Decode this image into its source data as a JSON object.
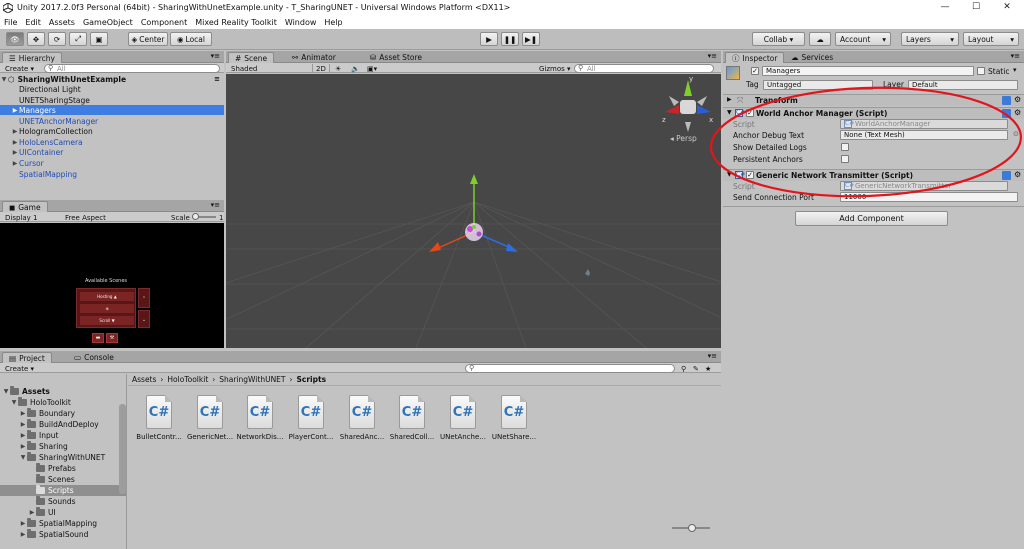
{
  "window": {
    "title": "Unity 2017.2.0f3 Personal (64bit) - SharingWithUnetExample.unity - T_SharingUNET - Universal Windows Platform <DX11>",
    "minimize": "—",
    "maximize": "☐",
    "close": "✕"
  },
  "menu": [
    "File",
    "Edit",
    "Assets",
    "GameObject",
    "Component",
    "Mixed Reality Toolkit",
    "Window",
    "Help"
  ],
  "toolbar": {
    "center": "Center",
    "local": "Local",
    "collab": "Collab ▾",
    "account": "Account",
    "layers": "Layers",
    "layout": "Layout"
  },
  "hierarchy": {
    "tab": "Hierarchy",
    "create": "Create ▾",
    "search_placeholder": "All",
    "scene_name": "SharingWithUnetExample",
    "items": [
      {
        "label": "Directional Light"
      },
      {
        "label": "UNETSharingStage"
      },
      {
        "label": "Managers"
      },
      {
        "label": "UNETAnchorManager"
      },
      {
        "label": "HologramCollection"
      },
      {
        "label": "HoloLensCamera"
      },
      {
        "label": "UIContainer"
      },
      {
        "label": "Cursor"
      },
      {
        "label": "SpatialMapping"
      }
    ]
  },
  "scene": {
    "tab": "Scene",
    "tab_animator": "Animator",
    "tab_asset_store": "Asset Store",
    "shading": "Shaded",
    "mode_2d": "2D",
    "gizmos": "Gizmos ▾",
    "search_placeholder": "All",
    "persp_label": "Persp",
    "gizmo_x": "x",
    "gizmo_y": "y",
    "gizmo_z": "z"
  },
  "game": {
    "tab": "Game",
    "display": "Display 1",
    "aspect": "Free Aspect",
    "scale_label": "Scale",
    "scale_value": "1",
    "menu_title": "Available Scenes",
    "menu_items": [
      "Hosting ▲",
      "⊕",
      "Scroll ▼"
    ]
  },
  "project": {
    "tab": "Project",
    "tab_console": "Console",
    "create": "Create ▾",
    "breadcrumb": [
      "Assets",
      "HoloToolkit",
      "SharingWithUNET",
      "Scripts"
    ],
    "tree": [
      {
        "label": "Assets"
      },
      {
        "label": "HoloToolkit"
      },
      {
        "label": "Boundary"
      },
      {
        "label": "BuildAndDeploy"
      },
      {
        "label": "Input"
      },
      {
        "label": "Sharing"
      },
      {
        "label": "SharingWithUNET"
      },
      {
        "label": "Prefabs"
      },
      {
        "label": "Scenes"
      },
      {
        "label": "Scripts"
      },
      {
        "label": "Sounds"
      },
      {
        "label": "UI"
      },
      {
        "label": "SpatialMapping"
      },
      {
        "label": "SpatialSound"
      }
    ],
    "files": [
      {
        "name": "BulletContr..."
      },
      {
        "name": "GenericNet..."
      },
      {
        "name": "NetworkDis..."
      },
      {
        "name": "PlayerCont..."
      },
      {
        "name": "SharedAnc..."
      },
      {
        "name": "SharedColl..."
      },
      {
        "name": "UNetAnche..."
      },
      {
        "name": "UNetShare..."
      }
    ]
  },
  "inspector": {
    "tab": "Inspector",
    "tab_services": "Services",
    "object_name": "Managers",
    "static_label": "Static",
    "tag_label": "Tag",
    "tag_value": "Untagged",
    "layer_label": "Layer",
    "layer_value": "Default",
    "components": {
      "transform": {
        "title": "Transform"
      },
      "world_anchor": {
        "title": "World Anchor Manager (Script)",
        "script_label": "Script",
        "script_value": "WorldAnchorManager",
        "debug_label": "Anchor Debug Text",
        "debug_value": "None (Text Mesh)",
        "detailed_logs_label": "Show Detailed Logs",
        "persistent_label": "Persistent Anchors"
      },
      "network_transmitter": {
        "title": "Generic Network Transmitter (Script)",
        "script_label": "Script",
        "script_value": "GenericNetworkTransmitter",
        "port_label": "Send Connection Port",
        "port_value": "11000"
      }
    },
    "add_component": "Add Component"
  },
  "colors": {
    "selection": "#3e7de1",
    "prefab_text": "#1f4bb8",
    "annotation_circle": "#e2141c",
    "scene_bg": "#474747"
  }
}
